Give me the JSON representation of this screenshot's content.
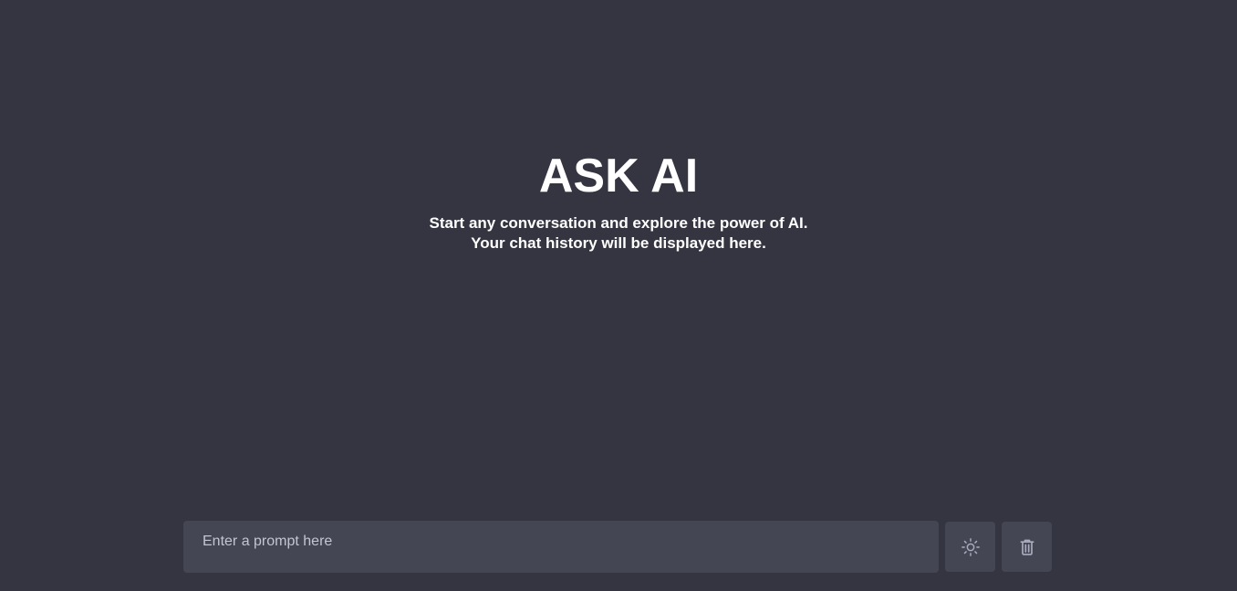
{
  "hero": {
    "title": "ASK AI",
    "subtitle_line1": "Start any conversation and explore the power of AI.",
    "subtitle_line2": "Your chat history will be displayed here."
  },
  "input": {
    "placeholder": "Enter a prompt here",
    "value": ""
  },
  "buttons": {
    "theme_icon": "sun-icon",
    "delete_icon": "trash-icon"
  },
  "colors": {
    "background": "#343541",
    "input_background": "#444654",
    "icon": "#acacbe"
  }
}
